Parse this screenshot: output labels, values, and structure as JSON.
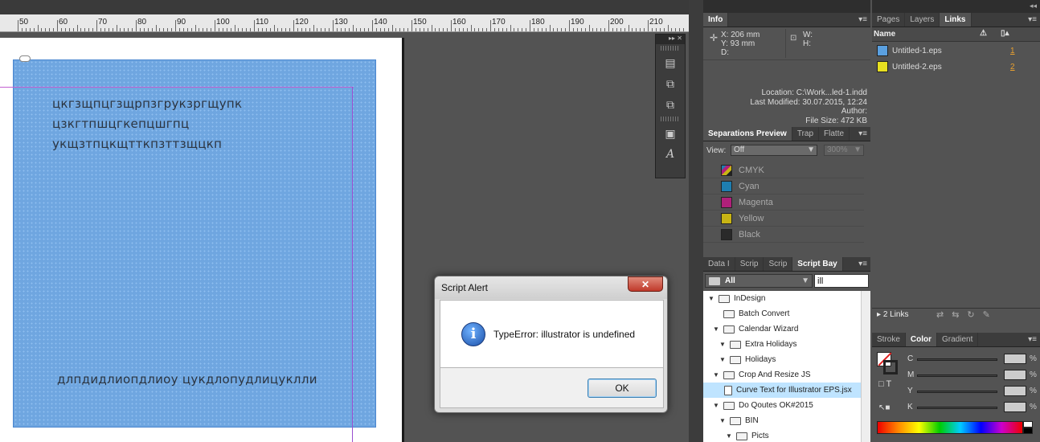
{
  "ruler": {
    "labels": [
      "50",
      "60",
      "70",
      "80",
      "90",
      "100",
      "110",
      "120",
      "130",
      "140",
      "150",
      "160",
      "170",
      "180",
      "190",
      "200",
      "210"
    ]
  },
  "document": {
    "text_lines": [
      "цкгзщпцгзщрпзгрукзргщупк",
      "цзкгтпшцгкепцшгпц",
      "укщзтпцкщтткпзттзщцкп"
    ],
    "bottom_text": "длпдидлиопдлиоу цукдлопудлицуклли"
  },
  "info": {
    "tab": "Info",
    "x": "X: 206 mm",
    "y": "Y: 93 mm",
    "d": "D:",
    "w": "W:",
    "h": "H:",
    "location": "Location: C:\\Work...led-1.indd",
    "modified": "Last Modified: 30.07.2015, 12:24",
    "author": "Author:",
    "size": "File Size: 472 KB"
  },
  "separations": {
    "tabs": [
      "Separations Preview",
      "Trap",
      "Flatte"
    ],
    "view_label": "View:",
    "view_value": "Off",
    "zoom": "300%",
    "rows": [
      {
        "name": "CMYK",
        "color": "#cmyk"
      },
      {
        "name": "Cyan",
        "color": "#1e7eb0"
      },
      {
        "name": "Magenta",
        "color": "#b0207a"
      },
      {
        "name": "Yellow",
        "color": "#c8b414"
      },
      {
        "name": "Black",
        "color": "#2a2a2a"
      }
    ]
  },
  "scriptbay": {
    "tabs": [
      "Data I",
      "Scrip",
      "Scrip",
      "Script Bay"
    ],
    "filter": "All",
    "search": "ill",
    "items": [
      {
        "label": "InDesign",
        "indent": 0,
        "tri": "▼",
        "type": "folder"
      },
      {
        "label": "Batch Convert",
        "indent": 1,
        "tri": "",
        "type": "folder"
      },
      {
        "label": "Calendar Wizard",
        "indent": 1,
        "tri": "▼",
        "type": "folder"
      },
      {
        "label": "Extra Holidays",
        "indent": 2,
        "tri": "▼",
        "type": "folder"
      },
      {
        "label": "Holidays",
        "indent": 2,
        "tri": "▼",
        "type": "folder"
      },
      {
        "label": "Crop And Resize JS",
        "indent": 1,
        "tri": "▼",
        "type": "folder"
      },
      {
        "label": "Curve Text for Illustrator EPS.jsx",
        "indent": 2,
        "tri": "",
        "type": "file",
        "selected": true
      },
      {
        "label": "Do Qoutes OK#2015",
        "indent": 1,
        "tri": "▼",
        "type": "folder"
      },
      {
        "label": "BIN",
        "indent": 2,
        "tri": "▼",
        "type": "folder"
      },
      {
        "label": "Picts",
        "indent": 3,
        "tri": "▼",
        "type": "folder"
      }
    ]
  },
  "links": {
    "tabs": [
      "Pages",
      "Layers",
      "Links"
    ],
    "col_name": "Name",
    "items": [
      {
        "name": "Untitled-1.eps",
        "page": "1",
        "color": "#5aa0e0"
      },
      {
        "name": "Untitled-2.eps",
        "page": "2",
        "color": "#e8e020"
      }
    ],
    "count": "2 Links"
  },
  "color": {
    "tabs": [
      "Stroke",
      "Color",
      "Gradient"
    ],
    "channels": [
      {
        "label": "C",
        "value": ""
      },
      {
        "label": "M",
        "value": ""
      },
      {
        "label": "Y",
        "value": ""
      },
      {
        "label": "K",
        "value": ""
      }
    ],
    "pct": "%"
  },
  "dialog": {
    "title": "Script Alert",
    "message": "TypeError: illustrator is undefined",
    "ok": "OK",
    "close": "✕"
  }
}
